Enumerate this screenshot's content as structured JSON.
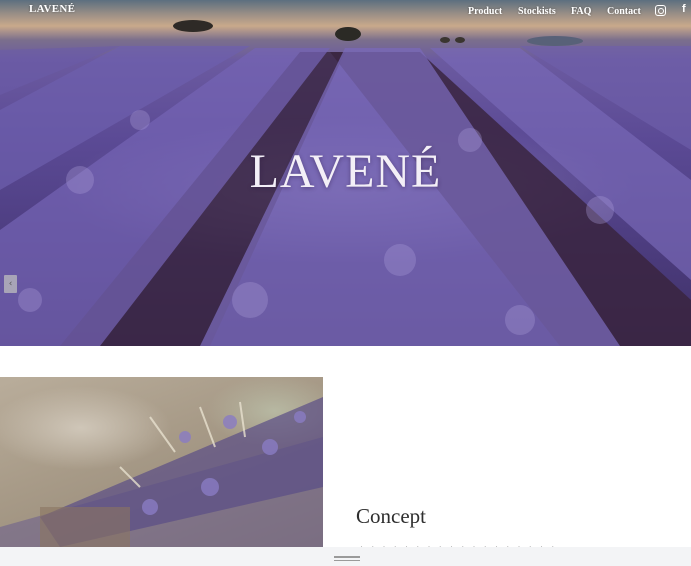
{
  "nav": {
    "brand": "LAVENÉ",
    "items": [
      "Product",
      "Stockists",
      "FAQ",
      "Contact"
    ],
    "social_icons": [
      "instagram-icon",
      "facebook-icon"
    ],
    "facebook_glyph": "f"
  },
  "hero": {
    "title": "LAVENÉ",
    "slider_arrow_glyph": "‹"
  },
  "concept": {
    "title": "Concept",
    "text": "· · · · · · · · · · · · · · · · · ·"
  },
  "colors": {
    "lavender": "#5b4a95",
    "hero_title": "#f3eff7",
    "concept_title": "#2e2e2e"
  }
}
